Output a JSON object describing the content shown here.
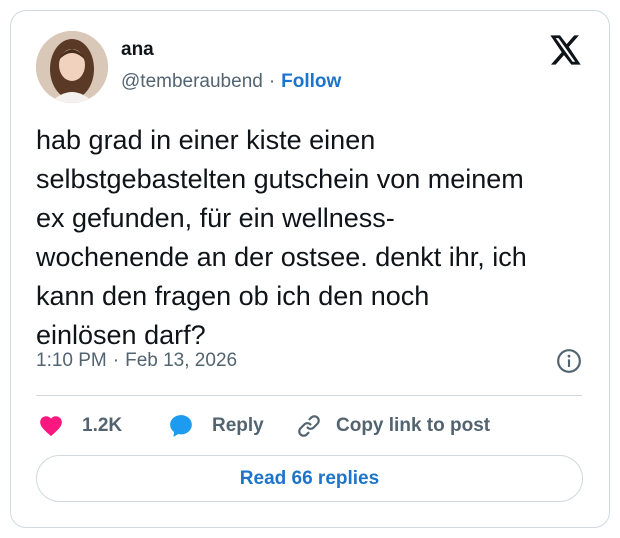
{
  "tweet": {
    "author_name": "ana",
    "handle": "@temberaubend",
    "separator": "·",
    "follow_label": "Follow",
    "text": "hab grad in einer kiste einen\nselbstgebastelten gutschein von meinem\nex gefunden, für ein wellness-\nwochenende an der ostsee. denkt ihr, ich\nkann den fragen ob ich den noch\neinlösen darf?",
    "time": "1:10 PM",
    "date": "Feb 13, 2026"
  },
  "actions": {
    "like_count": "1.2K",
    "reply_label": "Reply",
    "copy_label": "Copy link to post",
    "read_replies_label": "Read 66 replies"
  },
  "icons": {
    "brand": "x-logo-icon",
    "info": "info-icon",
    "like": "heart-icon",
    "reply": "speech-bubble-icon",
    "copy": "link-icon"
  },
  "colors": {
    "like": "#f91880",
    "reply": "#1d9bf0",
    "link": "#1d74c9",
    "muted": "#536471",
    "border": "#cfd9de"
  }
}
